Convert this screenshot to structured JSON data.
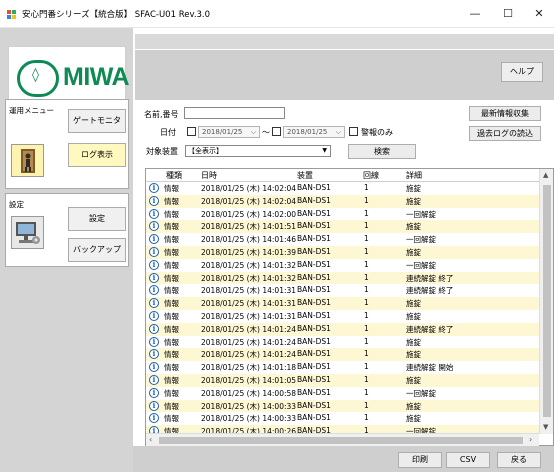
{
  "window": {
    "title": "安心門番シリーズ【統合版】 SFAC-U01 Rev.3.0",
    "minimize": "—",
    "maximize": "☐",
    "close": "✕"
  },
  "logo": {
    "text": "MIWA",
    "mark": "◊"
  },
  "sidebar": {
    "operation_menu": {
      "title": "運用メニュー",
      "gate_monitor": "ゲートモニタ",
      "log_view": "ログ表示"
    },
    "settings_menu": {
      "title": "設定",
      "settings": "設定",
      "backup": "バックアップ"
    }
  },
  "toolbar": {
    "help": "ヘルプ"
  },
  "filter": {
    "name_label": "名前,番号",
    "name_value": "",
    "date_label": "日付",
    "date_from": "2018/01/25",
    "date_tilde": "～",
    "date_to": "2018/01/25",
    "alarm_only": "警報のみ",
    "device_label": "対象装置",
    "device_value": "【全表示】",
    "search": "検索",
    "latest": "最新情報収集",
    "past_log": "過去ログの読込"
  },
  "table": {
    "columns": [
      "種類",
      "日時",
      "装置",
      "回線",
      "詳細"
    ],
    "rows": [
      {
        "type": "情報",
        "datetime": "2018/01/25 (木) 14:02:04",
        "device": "BAN-DS1",
        "line": "1",
        "detail": "施錠"
      },
      {
        "type": "情報",
        "datetime": "2018/01/25 (木) 14:02:04",
        "device": "BAN-DS1",
        "line": "1",
        "detail": "施錠"
      },
      {
        "type": "情報",
        "datetime": "2018/01/25 (木) 14:02:00",
        "device": "BAN-DS1",
        "line": "1",
        "detail": "一回解錠"
      },
      {
        "type": "情報",
        "datetime": "2018/01/25 (木) 14:01:51",
        "device": "BAN-DS1",
        "line": "1",
        "detail": "施錠"
      },
      {
        "type": "情報",
        "datetime": "2018/01/25 (木) 14:01:46",
        "device": "BAN-DS1",
        "line": "1",
        "detail": "一回解錠"
      },
      {
        "type": "情報",
        "datetime": "2018/01/25 (木) 14:01:39",
        "device": "BAN-DS1",
        "line": "1",
        "detail": "施錠"
      },
      {
        "type": "情報",
        "datetime": "2018/01/25 (木) 14:01:32",
        "device": "BAN-DS1",
        "line": "1",
        "detail": "一回解錠"
      },
      {
        "type": "情報",
        "datetime": "2018/01/25 (木) 14:01:32",
        "device": "BAN-DS1",
        "line": "1",
        "detail": "連続解錠 終了"
      },
      {
        "type": "情報",
        "datetime": "2018/01/25 (木) 14:01:31",
        "device": "BAN-DS1",
        "line": "1",
        "detail": "連続解錠 終了"
      },
      {
        "type": "情報",
        "datetime": "2018/01/25 (木) 14:01:31",
        "device": "BAN-DS1",
        "line": "1",
        "detail": "施錠"
      },
      {
        "type": "情報",
        "datetime": "2018/01/25 (木) 14:01:31",
        "device": "BAN-DS1",
        "line": "1",
        "detail": "施錠"
      },
      {
        "type": "情報",
        "datetime": "2018/01/25 (木) 14:01:24",
        "device": "BAN-DS1",
        "line": "1",
        "detail": "連続解錠 終了"
      },
      {
        "type": "情報",
        "datetime": "2018/01/25 (木) 14:01:24",
        "device": "BAN-DS1",
        "line": "1",
        "detail": "施錠"
      },
      {
        "type": "情報",
        "datetime": "2018/01/25 (木) 14:01:24",
        "device": "BAN-DS1",
        "line": "1",
        "detail": "施錠"
      },
      {
        "type": "情報",
        "datetime": "2018/01/25 (木) 14:01:18",
        "device": "BAN-DS1",
        "line": "1",
        "detail": "連続解錠 開始"
      },
      {
        "type": "情報",
        "datetime": "2018/01/25 (木) 14:01:05",
        "device": "BAN-DS1",
        "line": "1",
        "detail": "施錠"
      },
      {
        "type": "情報",
        "datetime": "2018/01/25 (木) 14:00:58",
        "device": "BAN-DS1",
        "line": "1",
        "detail": "一回解錠"
      },
      {
        "type": "情報",
        "datetime": "2018/01/25 (木) 14:00:33",
        "device": "BAN-DS1",
        "line": "1",
        "detail": "施錠"
      },
      {
        "type": "情報",
        "datetime": "2018/01/25 (木) 14:00:33",
        "device": "BAN-DS1",
        "line": "1",
        "detail": "施錠"
      },
      {
        "type": "情報",
        "datetime": "2018/01/25 (木) 14:00:26",
        "device": "BAN-DS1",
        "line": "1",
        "detail": "一回解錠"
      }
    ]
  },
  "footer": {
    "print": "印刷",
    "csv": "CSV",
    "back": "戻る"
  },
  "colors": {
    "brand_green": "#0e8a54",
    "row_alt": "#fdf7d4",
    "active_button": "#fff9c0",
    "info_blue": "#1d5fa8"
  },
  "icons": [
    "app-icon",
    "miwa-logo",
    "door-person-icon",
    "computer-icon",
    "info-icon",
    "dropdown-icon",
    "calendar-dropdown-icon"
  ]
}
